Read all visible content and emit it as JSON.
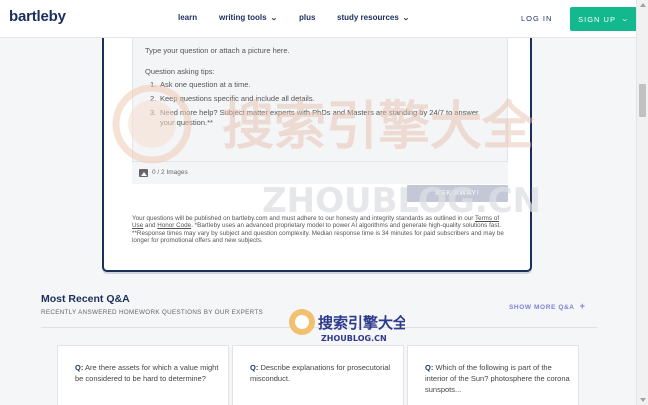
{
  "header": {
    "logo": "bartleby",
    "nav": [
      {
        "label": "learn",
        "has_dropdown": false
      },
      {
        "label": "writing tools",
        "has_dropdown": true
      },
      {
        "label": "plus",
        "has_dropdown": false
      },
      {
        "label": "study resources",
        "has_dropdown": true
      }
    ],
    "login": "LOG IN",
    "signup": "SIGN UP"
  },
  "ask": {
    "placeholder": "Type your question or attach a picture here.",
    "tips_title": "Question asking tips:",
    "tips": [
      {
        "num": "1.",
        "text": "Ask one question at a time."
      },
      {
        "num": "2.",
        "text": "Keep questions specific and include all details."
      },
      {
        "num": "3.",
        "text": "Need more help? Subject matter experts with PhDs and Masters are standing by 24/7 to answer your question.**"
      }
    ],
    "images_count": "0 / 2 Images",
    "ask_button": "ASK AWAY!",
    "disclaimer_1": "Your questions will be published on bartleby.com and must adhere to our honesty and integrity standards as outlined in our",
    "terms": "Terms of Use",
    "and": "and",
    "honor": "Honor Code",
    "disclaimer_2": ". *Bartleby uses an advanced proprietary model to power AI algorithms and generate high-quality solutions fast. **Response times may vary by subject and question complexity. Median response time is 34 minutes for paid subscribers and may be longer for promotional offers and new subjects."
  },
  "recent": {
    "title": "Most Recent Q&A",
    "subtitle": "RECENTLY ANSWERED HOMEWORK QUESTIONS BY OUR EXPERTS",
    "show_more": "SHOW MORE Q&A",
    "cards": [
      {
        "prefix": "Q:",
        "text": "Are there assets for which a value might be considered to be hard to determine?"
      },
      {
        "prefix": "Q:",
        "text": "Describe explanations for prosecutorial misconduct."
      },
      {
        "prefix": "Q:",
        "text": "Which of the following is part of the interior of the Sun? photosphere the corona     sunspots..."
      }
    ]
  },
  "watermark": {
    "cn": "搜索引擎大全",
    "url": "ZHOUBLOG.CN"
  },
  "colors": {
    "brand": "#1b2f5c",
    "signup": "#13b88f",
    "accent": "#7d7fd6"
  }
}
